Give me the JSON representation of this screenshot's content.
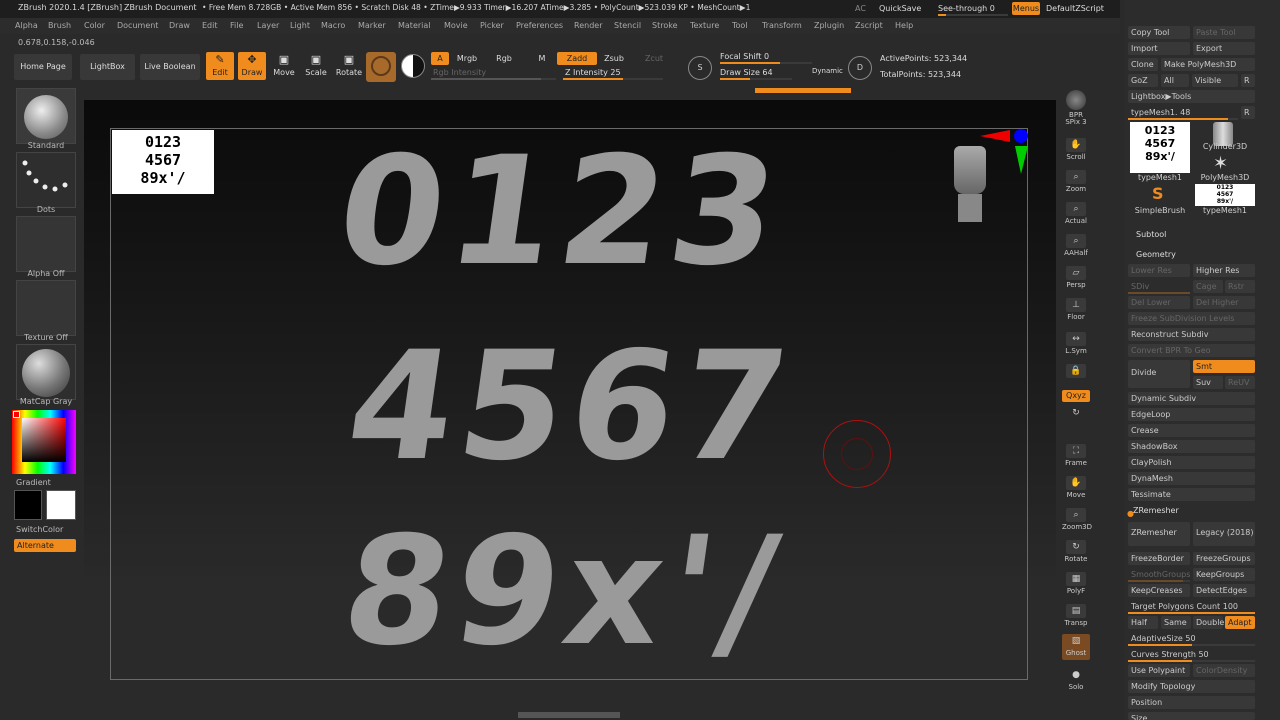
{
  "titlebar": {
    "app": "ZBrush 2020.1.4 [ZBrush]",
    "doc": "ZBrush Document",
    "stats": "• Free Mem 8.728GB • Active Mem 856 • Scratch Disk 48 • ZTime▶9.933 Timer▶16.207 ATime▶3.285 • PolyCount▶523.039 KP • MeshCount▶1",
    "ac": "AC",
    "quicksave": "QuickSave",
    "seethrough": "See-through  0",
    "menus": "Menus",
    "script": "DefaultZScript"
  },
  "menu": [
    "Alpha",
    "Brush",
    "Color",
    "Document",
    "Draw",
    "Edit",
    "File",
    "Layer",
    "Light",
    "Macro",
    "Marker",
    "Material",
    "Movie",
    "Picker",
    "Preferences",
    "Render",
    "Stencil",
    "Stroke",
    "Texture",
    "Tool",
    "Transform",
    "Zplugin",
    "Zscript",
    "Help"
  ],
  "coords": "0.678,0.158,-0.046",
  "toolbar": {
    "home": "Home Page",
    "lightbox": "LightBox",
    "liveboolean": "Live Boolean",
    "edit": "Edit",
    "draw": "Draw",
    "move": "Move",
    "scale": "Scale",
    "rotate": "Rotate",
    "a": "A",
    "mrgb": "Mrgb",
    "rgb": "Rgb",
    "m": "M",
    "zadd": "Zadd",
    "zsub": "Zsub",
    "zcut": "Zcut",
    "rgb_intensity": "Rgb Intensity",
    "z_intensity": "Z Intensity 25",
    "focal_shift": "Focal Shift 0",
    "draw_size": "Draw Size 64",
    "dynamic": "Dynamic",
    "active_points": "ActivePoints: 523,344",
    "total_points": "TotalPoints: 523,344"
  },
  "left": {
    "standard": "Standard",
    "dots": "Dots",
    "alpha": "Alpha Off",
    "texture": "Texture Off",
    "matcap": "MatCap Gray",
    "gradient": "Gradient",
    "switchcolor": "SwitchColor",
    "alternate": "Alternate"
  },
  "canvas": {
    "doc_lines": [
      "0123",
      "4567",
      "89x'/"
    ],
    "row1": "0123",
    "row2": "4567",
    "row3": "89x'/"
  },
  "right": [
    "BPR",
    "SPix 3",
    "Scroll",
    "Zoom",
    "Actual",
    "AAHalf",
    "Persp",
    "Floor",
    "L.Sym",
    "Qxyz",
    "Frame",
    "Move",
    "Zoom3D",
    "Rotate",
    "PolyF",
    "Transp",
    "Ghost",
    "Solo"
  ],
  "panel": {
    "copytool": "Copy Tool",
    "pastetool": "Paste Tool",
    "import": "Import",
    "export": "Export",
    "clone": "Clone",
    "polymesh": "Make PolyMesh3D",
    "goz": "GoZ",
    "all": "All",
    "visible": "Visible",
    "r": "R",
    "lightbox_tools": "Lightbox▶Tools",
    "typemesh": "typeMesh1. 48",
    "tools": [
      "typeMesh1",
      "Cylinder3D",
      "PolyMesh3D",
      "SimpleBrush",
      "typeMesh1"
    ],
    "subtool": "Subtool",
    "geometry": "Geometry",
    "lower": "Lower Res",
    "higher": "Higher Res",
    "sdiv": "SDiv",
    "cage": "Cage",
    "rstr": "Rstr",
    "dellower": "Del Lower",
    "delhigher": "Del Higher",
    "freeze": "Freeze SubDivision Levels",
    "reconstruct": "Reconstruct Subdiv",
    "convert": "Convert BPR To Geo",
    "divide": "Divide",
    "smt": "Smt",
    "suv": "Suv",
    "reuv": "ReUV",
    "items": [
      "Dynamic Subdiv",
      "EdgeLoop",
      "Crease",
      "ShadowBox",
      "ClayPolish",
      "DynaMesh",
      "Tessimate"
    ],
    "zremesher_h": "ZRemesher",
    "zremesher": "ZRemesher",
    "legacy": "Legacy (2018)",
    "freezeborder": "FreezeBorder",
    "freezegroups": "FreezeGroups",
    "smoothgroups": "SmoothGroups",
    "keepgroups": "KeepGroups",
    "keepcreases": "KeepCreases",
    "detectedges": "DetectEdges",
    "target": "Target Polygons Count 100",
    "half": "Half",
    "same": "Same",
    "double": "Double",
    "adapt": "Adapt",
    "adaptive": "AdaptiveSize 50",
    "curves": "Curves Strength 50",
    "usepoly": "Use Polypaint",
    "colordensity": "ColorDensity",
    "modify": "Modify Topology",
    "position": "Position",
    "size": "Size"
  }
}
